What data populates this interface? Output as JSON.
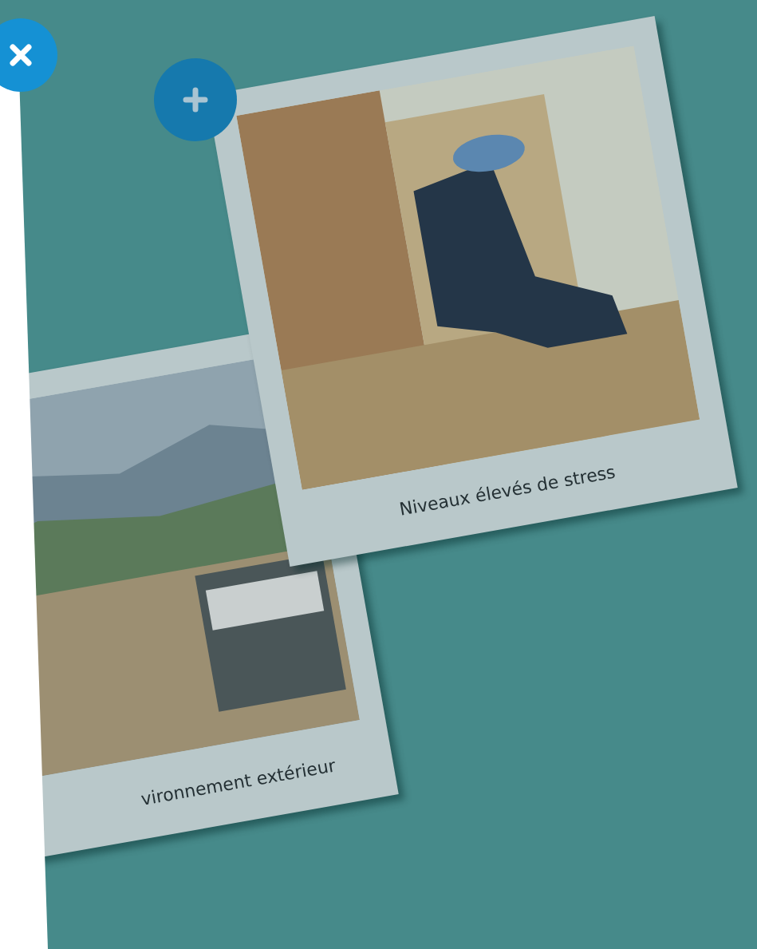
{
  "cards": [
    {
      "caption": "vironnement extérieur",
      "kind": "street"
    },
    {
      "caption": "Niveaux élevés de stress",
      "kind": "portrait"
    }
  ]
}
